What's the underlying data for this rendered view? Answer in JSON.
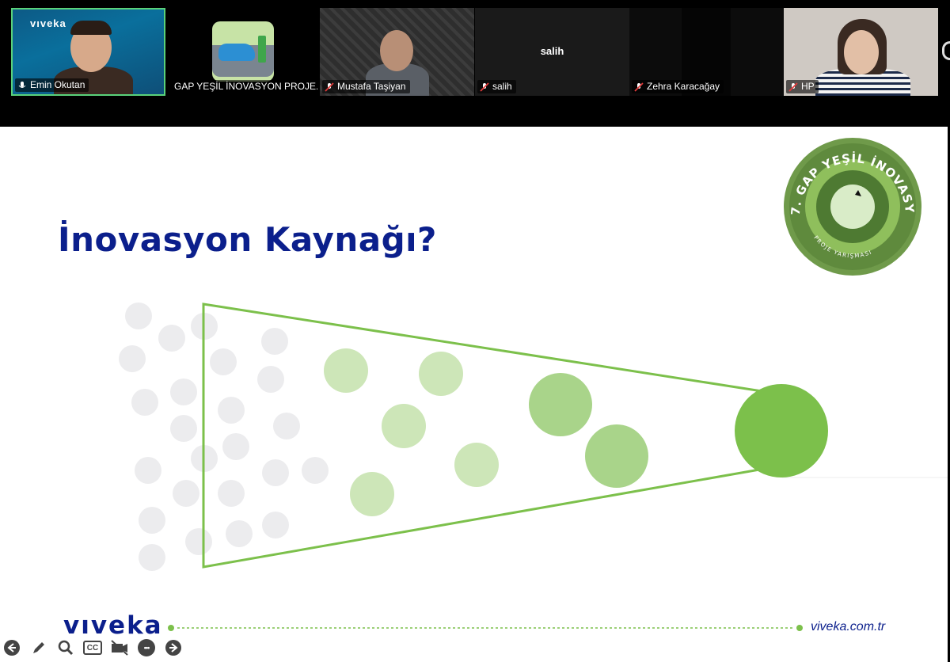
{
  "participants": [
    {
      "name": "Emin Okutan",
      "muted": false,
      "active": true,
      "overlay_brand": "vıveka"
    },
    {
      "name": "GAP YEŞİL İNOVASYON PROJE...",
      "muted": true,
      "active": false
    },
    {
      "name": "Mustafa Taşiyan",
      "muted": true,
      "active": false
    },
    {
      "name": "salih",
      "muted": true,
      "active": false,
      "center_label": "salih"
    },
    {
      "name": "Zehra Karacağay",
      "muted": true,
      "active": false
    },
    {
      "name": "HP",
      "muted": true,
      "active": false
    }
  ],
  "slide": {
    "title": "İnovasyon Kaynağı?",
    "brand": "vıveka",
    "website": "viveka.com.tr",
    "logo": {
      "ring_text": "7. GAP YEŞİL İNOVASYON",
      "sub_text": "PROJE YARIŞMASI"
    },
    "colors": {
      "title": "#0b1f8c",
      "funnel": "#7cc04b",
      "gray_dot": "#ececee",
      "light_green": "#cde6b8",
      "mid_green": "#a9d48a",
      "dark_green": "#7cc04b"
    }
  },
  "toolbar": {
    "buttons": [
      {
        "icon": "back-arrow-icon"
      },
      {
        "icon": "pencil-icon"
      },
      {
        "icon": "zoom-icon"
      },
      {
        "icon": "captions-icon",
        "label": "CC"
      },
      {
        "icon": "camera-off-icon"
      },
      {
        "icon": "more-icon",
        "label": "•••"
      },
      {
        "icon": "forward-arrow-icon"
      }
    ]
  }
}
